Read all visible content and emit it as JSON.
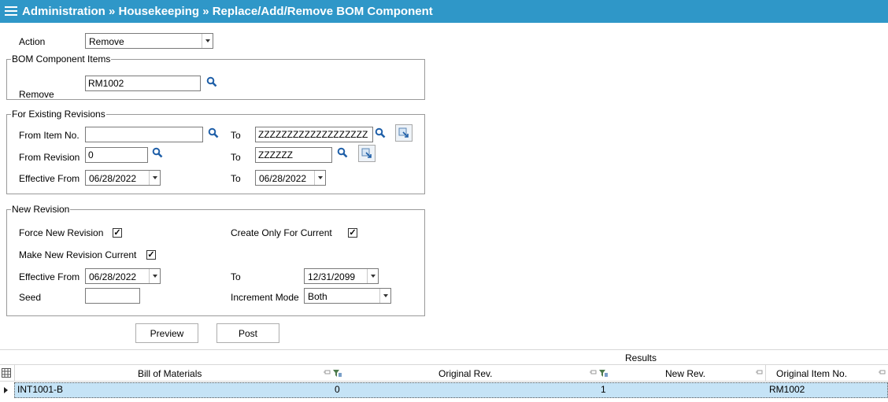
{
  "header": {
    "title": "Administration » Housekeeping » Replace/Add/Remove BOM Component"
  },
  "action": {
    "label": "Action",
    "value": "Remove"
  },
  "bom_items": {
    "legend": "BOM Component Items",
    "remove_label": "Remove",
    "remove_value": "RM1002"
  },
  "existing": {
    "legend": "For Existing Revisions",
    "from_item_label": "From Item No.",
    "from_item_value": "",
    "to_label": "To",
    "to_item_value": "ZZZZZZZZZZZZZZZZZZZ",
    "from_rev_label": "From Revision",
    "from_rev_value": "0",
    "to_rev_value": "ZZZZZZ",
    "eff_from_label": "Effective From",
    "eff_from_value": "06/28/2022",
    "eff_to_value": "06/28/2022"
  },
  "new_revision": {
    "legend": "New Revision",
    "force_label": "Force New Revision",
    "force_checked": "✓",
    "create_only_label": "Create Only For Current",
    "create_only_checked": "✓",
    "make_current_label": "Make New Revision Current",
    "make_current_checked": "✓",
    "eff_from_label": "Effective From",
    "eff_from_value": "06/28/2022",
    "to_label": "To",
    "to_value": "12/31/2099",
    "seed_label": "Seed",
    "seed_value": "",
    "increment_label": "Increment Mode",
    "increment_value": "Both"
  },
  "buttons": {
    "preview": "Preview",
    "post": "Post"
  },
  "results": {
    "title": "Results",
    "columns": [
      "Bill of Materials",
      "Original Rev.",
      "New Rev.",
      "Original Item No."
    ],
    "rows": [
      {
        "bom": "INT1001-B",
        "orig_rev": "0",
        "new_rev": "1",
        "orig_item": "RM1002"
      }
    ]
  },
  "colors": {
    "titlebar": "#2f97c8",
    "selected_row": "#c5e3f6",
    "icon_blue": "#1f5fa8"
  }
}
